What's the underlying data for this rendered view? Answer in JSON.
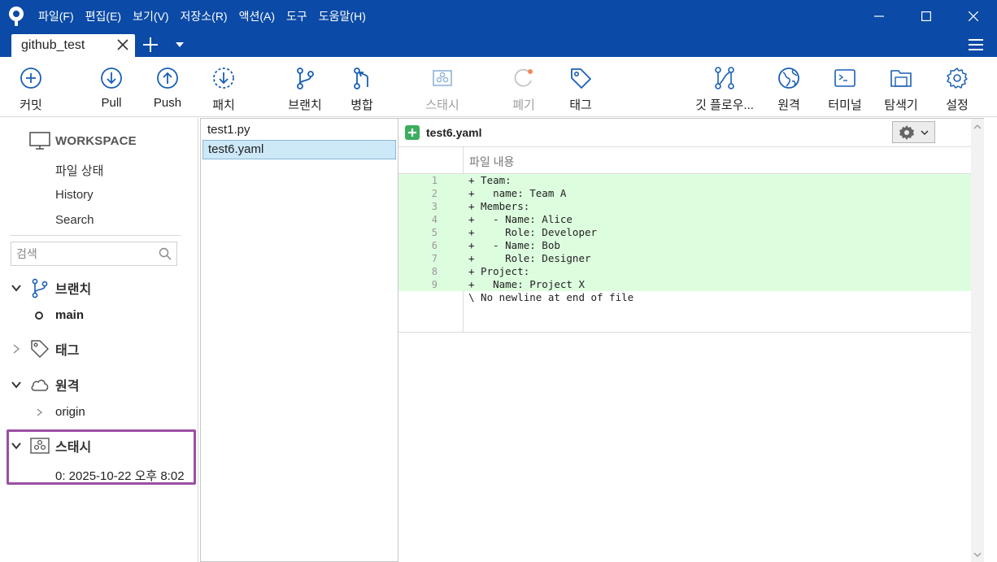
{
  "menu": {
    "items": [
      "파일(F)",
      "편집(E)",
      "보기(V)",
      "저장소(R)",
      "액션(A)",
      "도구",
      "도움말(H)"
    ]
  },
  "tab": {
    "title": "github_test"
  },
  "toolbar": {
    "commit": "커밋",
    "pull": "Pull",
    "push": "Push",
    "fetch": "패치",
    "branch": "브랜치",
    "merge": "병합",
    "stash": "스태시",
    "discard": "폐기",
    "tag": "태그",
    "gitflow": "깃 플로우...",
    "remote": "원격",
    "terminal": "터미널",
    "explorer": "탐색기",
    "settings": "설정"
  },
  "sidebar": {
    "workspace_title": "WORKSPACE",
    "workspace_items": [
      "파일 상태",
      "History",
      "Search"
    ],
    "search_placeholder": "검색",
    "branches": {
      "label": "브랜치",
      "items": [
        "main"
      ]
    },
    "tags": {
      "label": "태그"
    },
    "remotes": {
      "label": "원격",
      "items": [
        "origin"
      ]
    },
    "stashes": {
      "label": "스태시",
      "items": [
        "0: 2025-10-22 오후 8:02"
      ]
    }
  },
  "files": {
    "items": [
      "test1.py",
      "test6.yaml"
    ],
    "selected": "test6.yaml"
  },
  "diff": {
    "filename": "test6.yaml",
    "hunk_title": "파일 내용",
    "lines": [
      {
        "num": "1",
        "text": "+ Team:"
      },
      {
        "num": "2",
        "text": "+   name: Team A"
      },
      {
        "num": "3",
        "text": "+ Members:"
      },
      {
        "num": "4",
        "text": "+   - Name: Alice"
      },
      {
        "num": "5",
        "text": "+     Role: Developer"
      },
      {
        "num": "6",
        "text": "+   - Name: Bob"
      },
      {
        "num": "7",
        "text": "+     Role: Designer"
      },
      {
        "num": "8",
        "text": "+ Project:"
      },
      {
        "num": "9",
        "text": "+   Name: Project X"
      }
    ],
    "no_newline": "\\ No newline at end of file"
  },
  "colors": {
    "titlebar": "#0b4aa6",
    "accent": "#1a5fb4",
    "added_bg": "#ddfddf",
    "stash_highlight": "#9b4fa3",
    "selected_row": "#cde8f6"
  }
}
